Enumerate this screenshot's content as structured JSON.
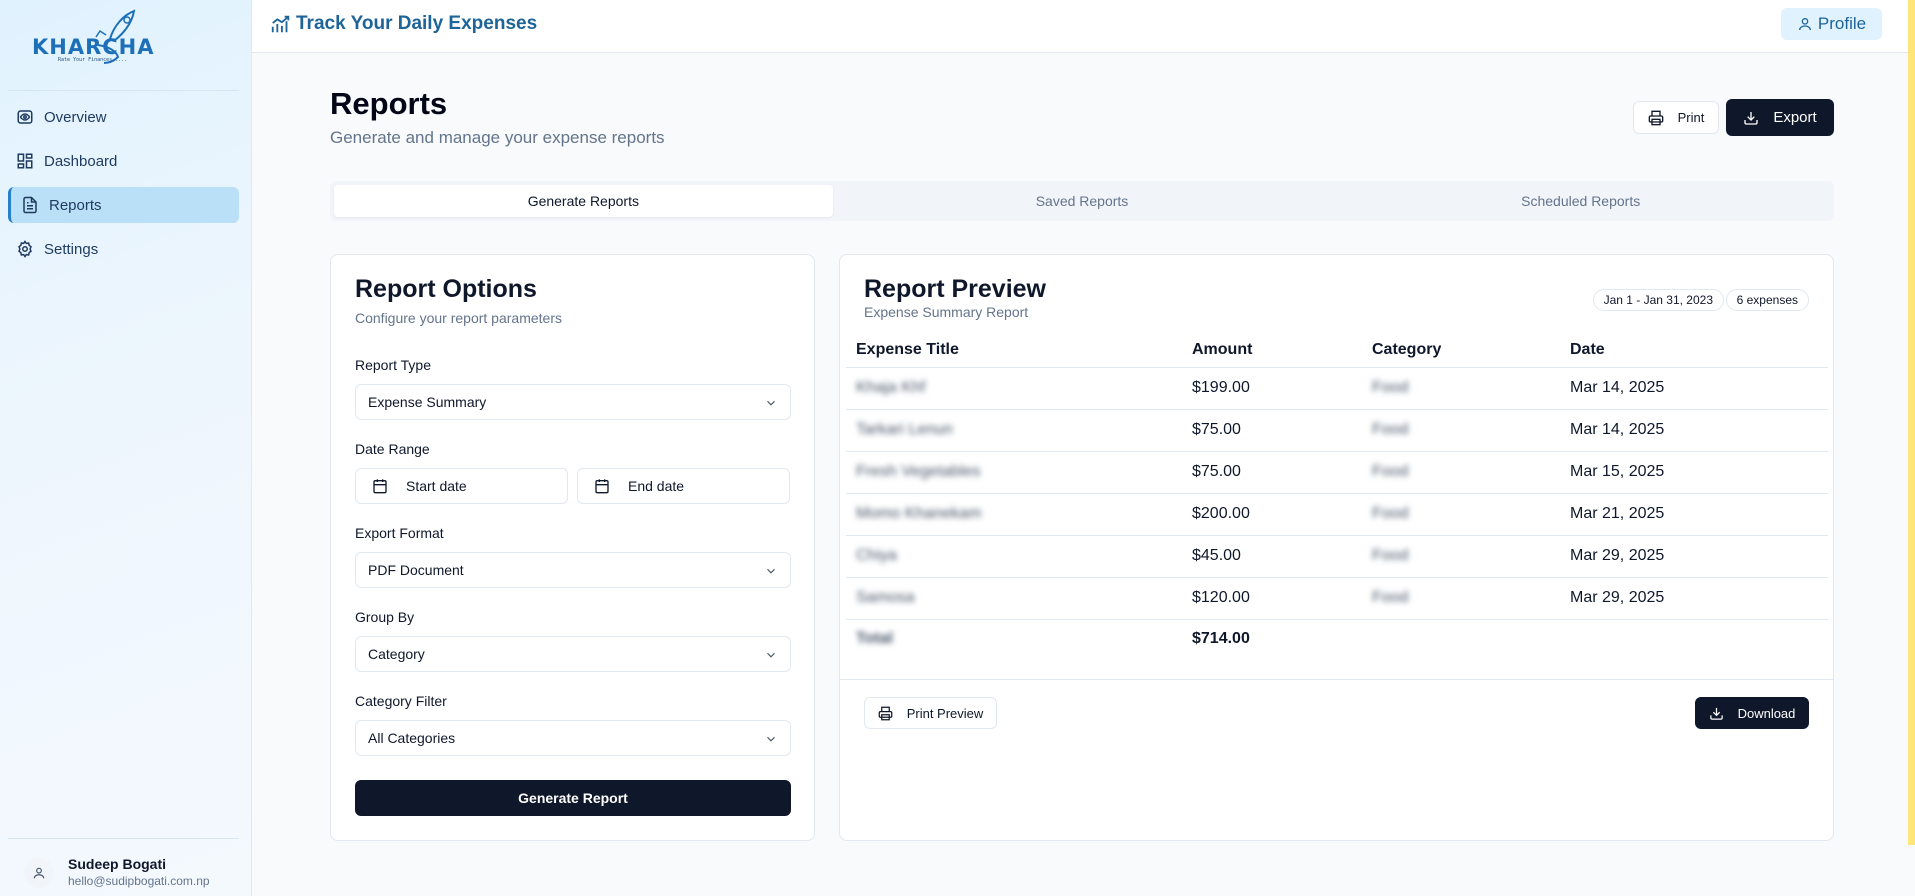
{
  "brand": {
    "logo_text": "KHARCHA",
    "logo_tagline": "Rate Your Finances....."
  },
  "sidebar": {
    "items": [
      {
        "label": "Overview",
        "icon": "eye-icon"
      },
      {
        "label": "Dashboard",
        "icon": "layout-grid-icon"
      },
      {
        "label": "Reports",
        "icon": "file-text-icon",
        "active": true
      },
      {
        "label": "Settings",
        "icon": "gear-icon"
      }
    ],
    "user": {
      "name": "Sudeep Bogati",
      "email": "hello@sudipbogati.com.np"
    }
  },
  "topbar": {
    "title": "Track Your Daily Expenses",
    "profile_label": "Profile"
  },
  "header": {
    "title": "Reports",
    "subtitle": "Generate and manage your expense reports",
    "print_label": "Print",
    "export_label": "Export"
  },
  "tabs": [
    {
      "label": "Generate Reports",
      "active": true
    },
    {
      "label": "Saved Reports"
    },
    {
      "label": "Scheduled Reports"
    }
  ],
  "options": {
    "title": "Report Options",
    "subtitle": "Configure your report parameters",
    "report_type_label": "Report Type",
    "report_type_value": "Expense Summary",
    "date_range_label": "Date Range",
    "start_date_placeholder": "Start date",
    "end_date_placeholder": "End date",
    "export_format_label": "Export Format",
    "export_format_value": "PDF Document",
    "group_by_label": "Group By",
    "group_by_value": "Category",
    "category_filter_label": "Category Filter",
    "category_filter_value": "All Categories",
    "generate_label": "Generate Report"
  },
  "preview": {
    "title": "Report Preview",
    "subtitle": "Expense Summary Report",
    "date_badge": "Jan 1 - Jan 31, 2023",
    "count_badge": "6 expenses",
    "columns": [
      "Expense Title",
      "Amount",
      "Category",
      "Date"
    ],
    "rows": [
      {
        "title": "Khaja Khf",
        "amount": "$199.00",
        "category": "Food",
        "date": "Mar 14, 2025"
      },
      {
        "title": "Tarkari Lenun",
        "amount": "$75.00",
        "category": "Food",
        "date": "Mar 14, 2025"
      },
      {
        "title": "Fresh Vegetables",
        "amount": "$75.00",
        "category": "Food",
        "date": "Mar 15, 2025"
      },
      {
        "title": "Momo Khanekam",
        "amount": "$200.00",
        "category": "Food",
        "date": "Mar 21, 2025"
      },
      {
        "title": "Chiya",
        "amount": "$45.00",
        "category": "Food",
        "date": "Mar 29, 2025"
      },
      {
        "title": "Samosa",
        "amount": "$120.00",
        "category": "Food",
        "date": "Mar 29, 2025"
      }
    ],
    "total_label": "Total",
    "total_amount": "$714.00",
    "print_preview_label": "Print Preview",
    "download_label": "Download"
  },
  "colors": {
    "accent": "#1d6499",
    "primary_dark": "#0f172a",
    "active_nav": "#bae0f7"
  }
}
